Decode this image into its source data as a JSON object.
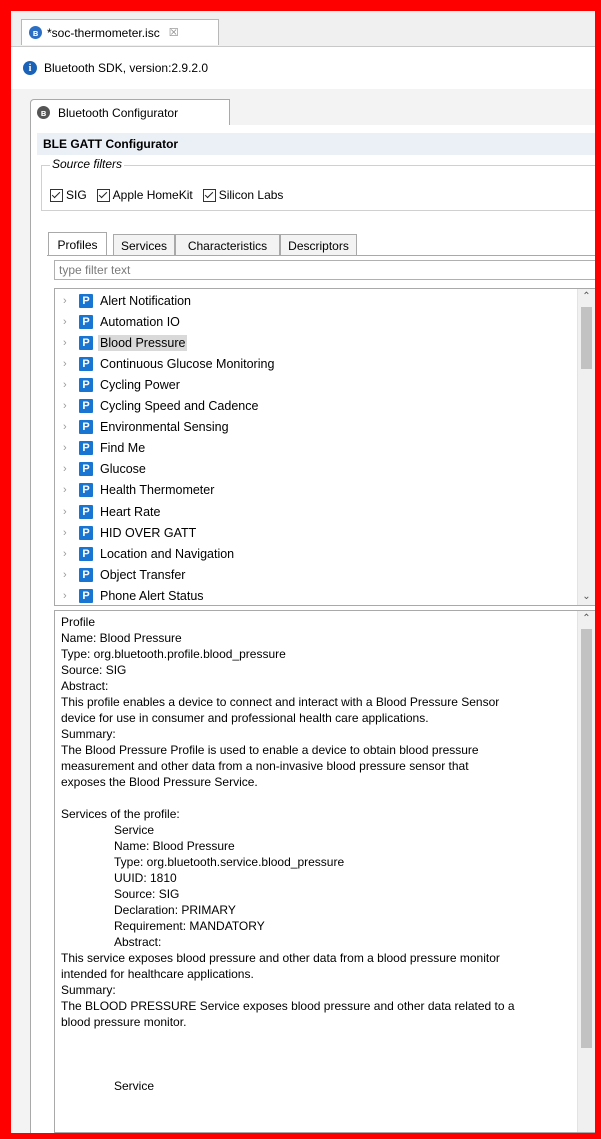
{
  "editor_tab": {
    "title": "*soc-thermometer.isc",
    "close": "☒"
  },
  "info": {
    "text": "Bluetooth SDK, version:2.9.2.0"
  },
  "configurator_tab": {
    "label": "Bluetooth Configurator"
  },
  "section_header": "BLE GATT Configurator",
  "source_filters": {
    "legend": "Source filters",
    "options": [
      {
        "label": "SIG",
        "checked": true
      },
      {
        "label": "Apple HomeKit",
        "checked": true
      },
      {
        "label": "Silicon Labs",
        "checked": true
      }
    ]
  },
  "tabs": [
    "Profiles",
    "Services",
    "Characteristics",
    "Descriptors"
  ],
  "active_tab": "Profiles",
  "filter_placeholder": "type filter text",
  "profiles": [
    "Alert Notification",
    "Automation IO",
    "Blood Pressure",
    "Continuous Glucose Monitoring",
    "Cycling Power",
    "Cycling Speed and Cadence",
    "Environmental Sensing",
    "Find Me",
    "Glucose",
    "Health Thermometer",
    "Heart Rate",
    "HID OVER GATT",
    "Location and Navigation",
    "Object Transfer",
    "Phone Alert Status"
  ],
  "selected_profile": "Blood Pressure",
  "detail_lines": [
    {
      "text": "Profile",
      "indent": false
    },
    {
      "text": "Name: Blood Pressure",
      "indent": false
    },
    {
      "text": "Type: org.bluetooth.profile.blood_pressure",
      "indent": false
    },
    {
      "text": "Source: SIG",
      "indent": false
    },
    {
      "text": "Abstract:",
      "indent": false
    },
    {
      "text": "This profile enables a device to connect and interact with a Blood Pressure Sensor",
      "indent": false
    },
    {
      "text": "device for use in consumer and professional health care applications.",
      "indent": false
    },
    {
      "text": "Summary:",
      "indent": false
    },
    {
      "text": "The Blood Pressure Profile is used to enable a device to obtain blood pressure",
      "indent": false
    },
    {
      "text": "measurement and other data from a non-invasive blood pressure sensor that",
      "indent": false
    },
    {
      "text": "exposes the Blood Pressure Service.",
      "indent": false
    },
    {
      "text": "",
      "indent": false
    },
    {
      "text": "Services of the profile:",
      "indent": false
    },
    {
      "text": "Service",
      "indent": true
    },
    {
      "text": "Name: Blood Pressure",
      "indent": true
    },
    {
      "text": "Type: org.bluetooth.service.blood_pressure",
      "indent": true
    },
    {
      "text": "UUID: 1810",
      "indent": true
    },
    {
      "text": "Source: SIG",
      "indent": true
    },
    {
      "text": "Declaration: PRIMARY",
      "indent": true
    },
    {
      "text": "Requirement: MANDATORY",
      "indent": true
    },
    {
      "text": "Abstract:",
      "indent": true
    },
    {
      "text": "This service exposes blood pressure and other data from a blood pressure monitor",
      "indent": false
    },
    {
      "text": "intended for healthcare applications.",
      "indent": false
    },
    {
      "text": "Summary:",
      "indent": false
    },
    {
      "text": "The BLOOD PRESSURE Service exposes blood pressure and other data related to a",
      "indent": false
    },
    {
      "text": "blood pressure monitor.",
      "indent": false
    },
    {
      "text": "",
      "indent": false
    },
    {
      "text": "",
      "indent": false
    },
    {
      "text": "",
      "indent": false
    },
    {
      "text": "Service",
      "indent": true
    }
  ],
  "icons": {
    "editor_tab": "bluetooth-icon",
    "info": "info-icon",
    "configurator_tab": "bluetooth-icon",
    "profile_item": "profile-p-icon",
    "expand": "chevron-right-icon"
  },
  "colors": {
    "frame_border": "#ff0000",
    "profile_icon": "#1975d2",
    "header_bg": "#ebf0f7",
    "selection_bg": "#d9d9d9"
  }
}
